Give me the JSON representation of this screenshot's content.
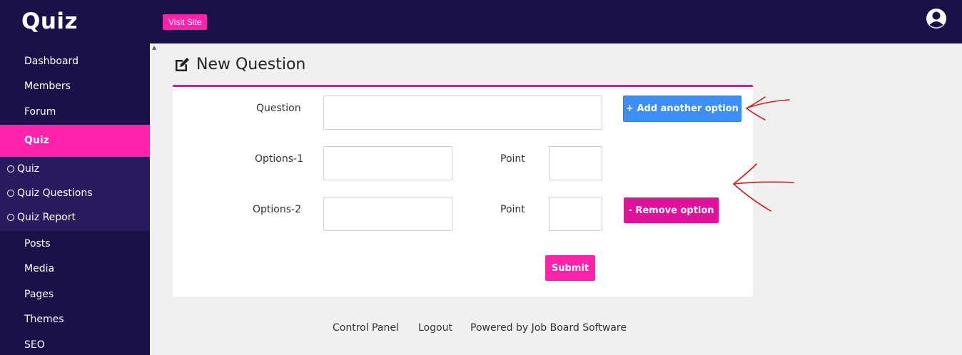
{
  "app": {
    "brand": "Quiz",
    "visit_site_label": "Visit Site"
  },
  "sidebar": {
    "items_top": [
      "Dashboard",
      "Members",
      "Forum"
    ],
    "active": "Quiz",
    "sub_items": [
      "Quiz",
      "Quiz Questions",
      "Quiz Report"
    ],
    "items_bottom": [
      "Posts",
      "Media",
      "Pages",
      "Themes",
      "SEO"
    ]
  },
  "page": {
    "title": "New Question"
  },
  "form": {
    "question_label": "Question",
    "question_value": "",
    "options": [
      {
        "label": "Options-1",
        "value": "",
        "point_label": "Point",
        "point_value": ""
      },
      {
        "label": "Options-2",
        "value": "",
        "point_label": "Point",
        "point_value": ""
      }
    ],
    "add_option_label": "+ Add another option",
    "remove_option_label": "- Remove option",
    "submit_label": "Submit"
  },
  "footer": {
    "links": [
      "Control Panel",
      "Logout",
      "Powered by Job Board Software"
    ]
  },
  "colors": {
    "nav_bg": "#1b1048",
    "accent_pink": "#ff22aa",
    "add_blue": "#3e8ef7",
    "annotation_red": "#d8161b"
  }
}
